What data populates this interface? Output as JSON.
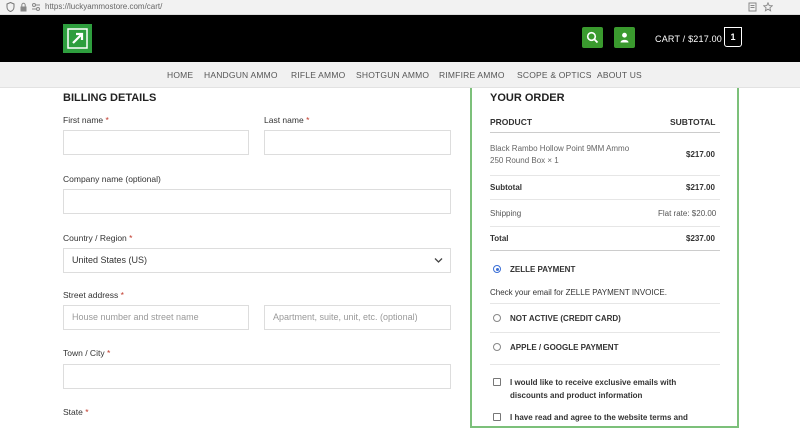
{
  "browser": {
    "url": "https://luckyammostore.com/cart/"
  },
  "header": {
    "cart_text": "CART / $217.00",
    "cart_count": "1"
  },
  "nav": {
    "items": [
      "HOME",
      "HANDGUN AMMO",
      "RIFLE AMMO",
      "SHOTGUN AMMO",
      "RIMFIRE AMMO",
      "SCOPE & OPTICS",
      "ABOUT US"
    ]
  },
  "billing": {
    "title": "BILLING DETAILS",
    "first_name_label": "First name",
    "last_name_label": "Last name",
    "company_label": "Company name (optional)",
    "country_label": "Country / Region",
    "country_value": "United States (US)",
    "street_label": "Street address",
    "street_placeholder": "House number and street name",
    "street2_placeholder": "Apartment, suite, unit, etc. (optional)",
    "city_label": "Town / City",
    "state_label": "State",
    "required_mark": "*"
  },
  "order": {
    "title": "YOUR ORDER",
    "col_product": "PRODUCT",
    "col_subtotal": "SUBTOTAL",
    "item_name_line1": "Black Rambo Hollow Point 9MM Ammo",
    "item_name_line2": "250 Round Box  × 1",
    "item_price": "$217.00",
    "subtotal_label": "Subtotal",
    "subtotal_value": "$217.00",
    "shipping_label": "Shipping",
    "shipping_value": "Flat rate: $20.00",
    "total_label": "Total",
    "total_value": "$237.00",
    "payment_zelle": "ZELLE PAYMENT",
    "zelle_note": "Check your email for ZELLE PAYMENT INVOICE.",
    "payment_card": "NOT ACTIVE (CREDIT CARD)",
    "payment_apple": "APPLE / GOOGLE PAYMENT",
    "emails_opt_line1": "I would like to receive exclusive emails with",
    "emails_opt_line2": "discounts and product information",
    "terms_text": "I have read and agree to the website terms and"
  }
}
